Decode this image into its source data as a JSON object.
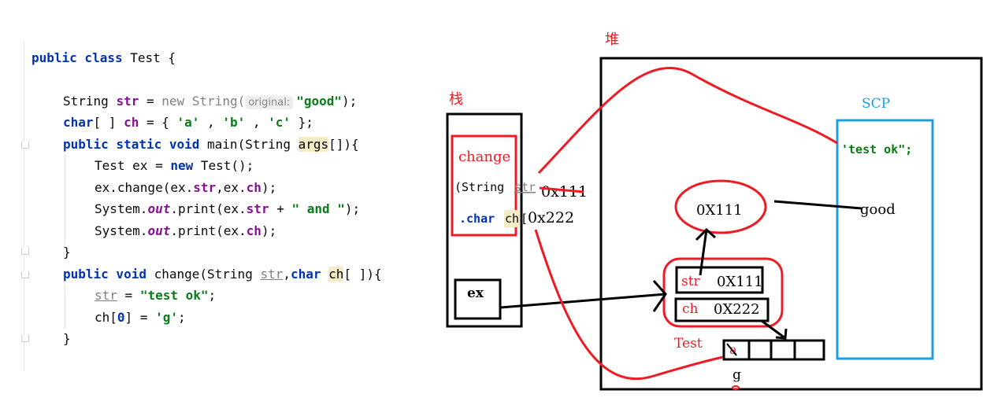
{
  "code": {
    "lines": [
      [
        {
          "t": "public class ",
          "c": "kw"
        },
        {
          "t": "Test {",
          "c": "plain"
        }
      ],
      [
        {
          "t": "String ",
          "c": "plain"
        },
        {
          "t": "str",
          "c": "fld"
        },
        {
          "t": " = ",
          "c": "plain"
        },
        {
          "t": "new String(",
          "c": "gray"
        },
        {
          "t": "original:",
          "c": "hint"
        },
        {
          "t": "\"good\"",
          "c": "str"
        },
        {
          "t": ");",
          "c": "plain"
        }
      ],
      [
        {
          "t": "char",
          "c": "kw"
        },
        {
          "t": "[ ] ",
          "c": "plain"
        },
        {
          "t": "ch",
          "c": "fld"
        },
        {
          "t": " = { ",
          "c": "plain"
        },
        {
          "t": "'a'",
          "c": "str"
        },
        {
          "t": " , ",
          "c": "plain"
        },
        {
          "t": "'b'",
          "c": "str"
        },
        {
          "t": " , ",
          "c": "plain"
        },
        {
          "t": "'c'",
          "c": "str"
        },
        {
          "t": " };",
          "c": "plain"
        }
      ],
      [
        {
          "t": "public static void ",
          "c": "kw"
        },
        {
          "t": "main(String ",
          "c": "plain"
        },
        {
          "t": "args",
          "c": "hl"
        },
        {
          "t": "[]){",
          "c": "plain"
        }
      ],
      [
        {
          "t": "Test ex = ",
          "c": "plain"
        },
        {
          "t": "new ",
          "c": "kw"
        },
        {
          "t": "Test();",
          "c": "plain"
        }
      ],
      [
        {
          "t": "ex.change(ex.",
          "c": "plain"
        },
        {
          "t": "str",
          "c": "fld"
        },
        {
          "t": ",ex.",
          "c": "plain"
        },
        {
          "t": "ch",
          "c": "fld"
        },
        {
          "t": ");",
          "c": "plain"
        }
      ],
      [
        {
          "t": "System.",
          "c": "plain"
        },
        {
          "t": "out",
          "c": "it"
        },
        {
          "t": ".print(ex.",
          "c": "plain"
        },
        {
          "t": "str",
          "c": "fld"
        },
        {
          "t": " + ",
          "c": "plain"
        },
        {
          "t": "\" and \"",
          "c": "str"
        },
        {
          "t": ");",
          "c": "plain"
        }
      ],
      [
        {
          "t": "System.",
          "c": "plain"
        },
        {
          "t": "out",
          "c": "it"
        },
        {
          "t": ".print(ex.",
          "c": "plain"
        },
        {
          "t": "ch",
          "c": "fld"
        },
        {
          "t": ");",
          "c": "plain"
        }
      ],
      [
        {
          "t": "}",
          "c": "plain"
        }
      ],
      [
        {
          "t": "public void ",
          "c": "kw"
        },
        {
          "t": "change(String ",
          "c": "plain"
        },
        {
          "t": "str",
          "c": "unused"
        },
        {
          "t": ",",
          "c": "plain"
        },
        {
          "t": "char ",
          "c": "kw"
        },
        {
          "t": "ch",
          "c": "hl"
        },
        {
          "t": "[ ]){",
          "c": "plain"
        }
      ],
      [
        {
          "t": "str",
          "c": "unused"
        },
        {
          "t": " = ",
          "c": "plain"
        },
        {
          "t": "\"test ok\"",
          "c": "str"
        },
        {
          "t": ";",
          "c": "plain"
        }
      ],
      [
        {
          "t": "ch[",
          "c": "plain"
        },
        {
          "t": "0",
          "c": "kw"
        },
        {
          "t": "] = ",
          "c": "plain"
        },
        {
          "t": "'g'",
          "c": "str"
        },
        {
          "t": ";",
          "c": "plain"
        }
      ],
      [
        {
          "t": "}",
          "c": "plain"
        }
      ]
    ]
  },
  "diagram": {
    "heap_label": "堆",
    "stack_label": "栈",
    "scp_label": "SCP",
    "frame_label": "change",
    "frame_param1_type": "(String ",
    "frame_param1_name": "str",
    "frame_param1_value": "0x111",
    "frame_param2_type": ".char ",
    "frame_param2_name": "ch",
    "frame_param2_bracket": "[",
    "frame_param2_value": "0x222",
    "ex_label": "ex",
    "scp_string1": "'test ok\";",
    "scp_string2": "good",
    "string_object_addr": "0X111",
    "object_field1_name": "str",
    "object_field1_value": "0X111",
    "object_field2_name": "ch",
    "object_field2_value": "0X222",
    "object_label": "Test",
    "array_cell0_old": "a",
    "array_cell0_new": "g",
    "colors": {
      "red": "#ed1c24",
      "blue": "#1ea0e0",
      "black": "#000000"
    }
  }
}
